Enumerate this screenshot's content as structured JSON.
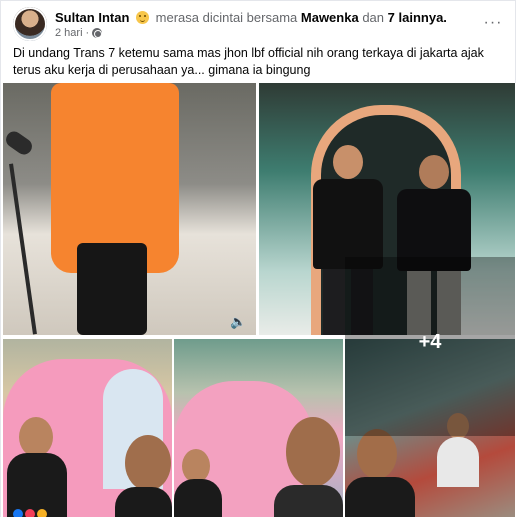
{
  "post": {
    "author": "Sultan Intan",
    "feeling": "merasa dicintai bersama",
    "tagged_friend": "Mawenka",
    "connector": "dan",
    "others": "7 lainnya.",
    "time": "2 hari",
    "privacy_icon": "globe-icon",
    "more_icon": "ellipsis-icon",
    "more_label": "···",
    "text": "Di undang Trans 7 ketemu sama mas jhon lbf official nih orang terkaya di jakarta ajak terus aku kerja di perusahaan ya... gimana ia bingung"
  },
  "gallery": {
    "extra_count": "+4",
    "speaker_label": "🔈"
  },
  "colors": {
    "secondary_text": "#65676b",
    "orange_jacket": "#f6842f",
    "feeling_emoji": "#f7c64b"
  }
}
